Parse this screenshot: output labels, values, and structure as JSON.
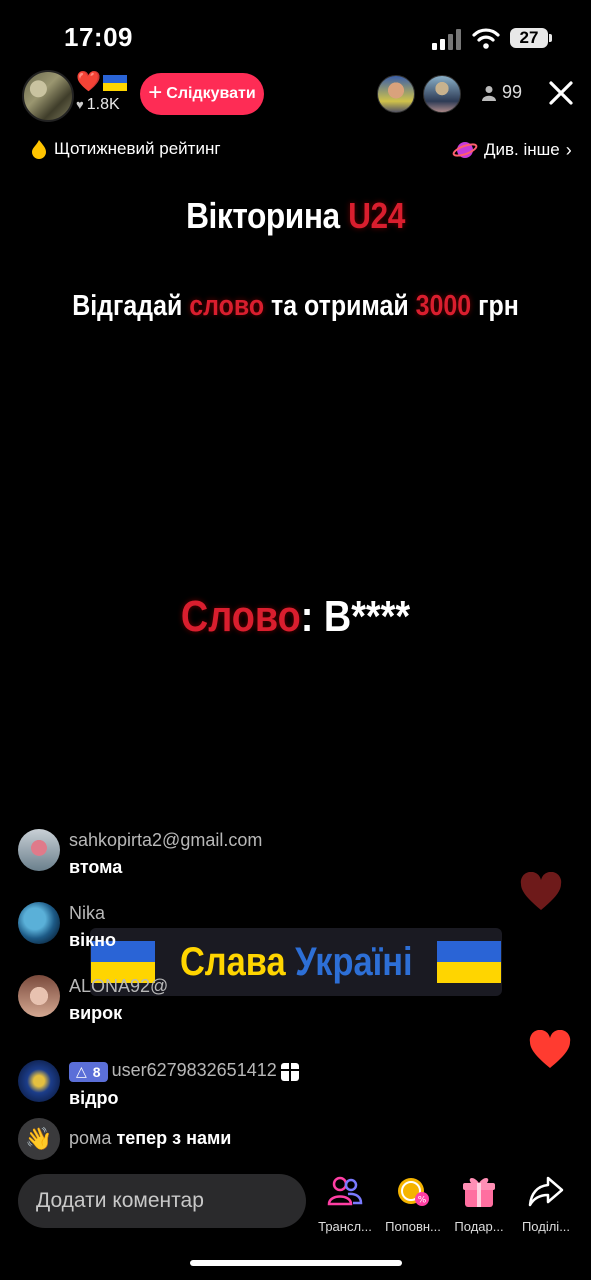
{
  "status_bar": {
    "time": "17:09",
    "battery": "27"
  },
  "header": {
    "host_likes": "1.8K",
    "follow_label": "Слідкувати",
    "viewer_count": "99"
  },
  "rating_row": {
    "weekly_label": "Щотижневий рейтинг",
    "explore_label": "Див. інше"
  },
  "stage": {
    "title_part1": "Вікторина ",
    "title_part2": "U24",
    "sub_part1": "Відгадай ",
    "sub_part2": "слово",
    "sub_part3": " та отримай ",
    "sub_part4": "3000",
    "sub_part5": " грн",
    "word_label": "Слово",
    "word_value": ": В****"
  },
  "banner": {
    "text_part1": "Слава ",
    "text_part2": "Україні"
  },
  "comments": [
    {
      "user": "sahkopirta2@gmail.com",
      "text": "втома"
    },
    {
      "user": "Nika",
      "text": "вікно"
    },
    {
      "user": "ALONA92@",
      "text": "вирок"
    },
    {
      "user": "user6279832651412",
      "badge_level": "8",
      "text": "відро"
    },
    {
      "user": "рома",
      "text": "тепер з нами"
    }
  ],
  "bottom_bar": {
    "comment_placeholder": "Додати коментар",
    "items": [
      {
        "label": "Трансл...",
        "icon": "people-icon"
      },
      {
        "label": "Поповн...",
        "icon": "coin-icon"
      },
      {
        "label": "Подар...",
        "icon": "gift-icon"
      },
      {
        "label": "Поділі...",
        "icon": "share-icon"
      }
    ]
  },
  "colors": {
    "follow": "#fe2c55",
    "accent_red": "#d91e2e",
    "heart": "#ff3b30",
    "badge": "#5b6fd8"
  }
}
